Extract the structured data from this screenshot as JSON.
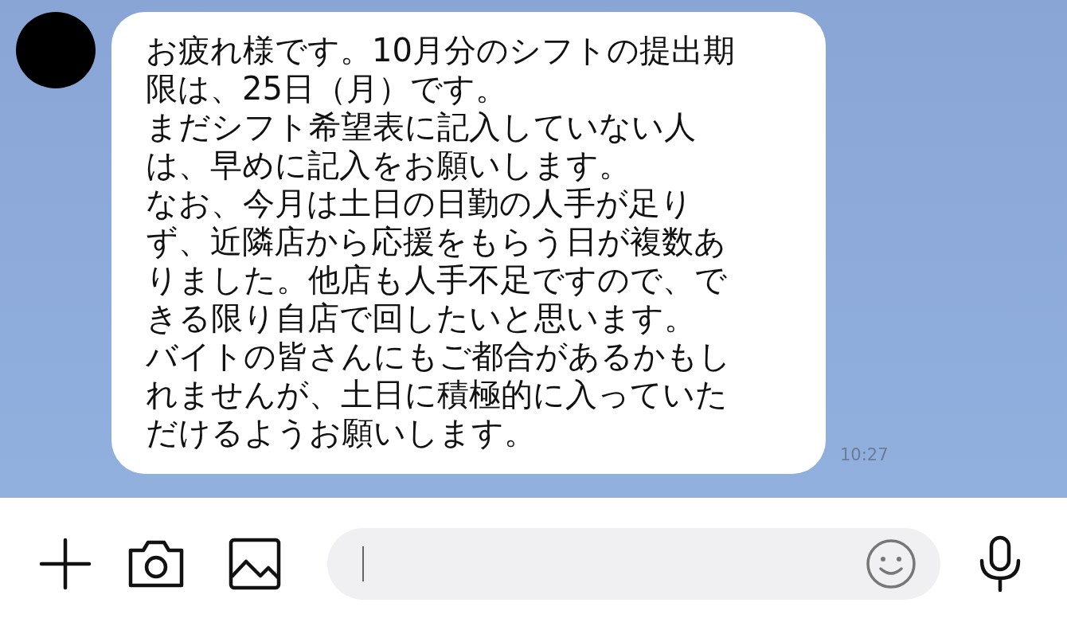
{
  "chat": {
    "messages": [
      {
        "kind": "incoming",
        "paragraphs": [
          "お疲れ様です。10月分のシフトの提出期限は、25日（月）です。",
          "まだシフト希望表に記入していない人は、早めに記入をお願いします。",
          "なお、今月は土日の日勤の人手が足りず、近隣店から応援をもらう日が複数ありました。他店も人手不足ですので、できる限り自店で回したいと思います。",
          "バイトの皆さんにもご都合があるかもしれませんが、土日に積極的に入っていただけるようお願いします。"
        ],
        "time": "10:27"
      }
    ]
  }
}
